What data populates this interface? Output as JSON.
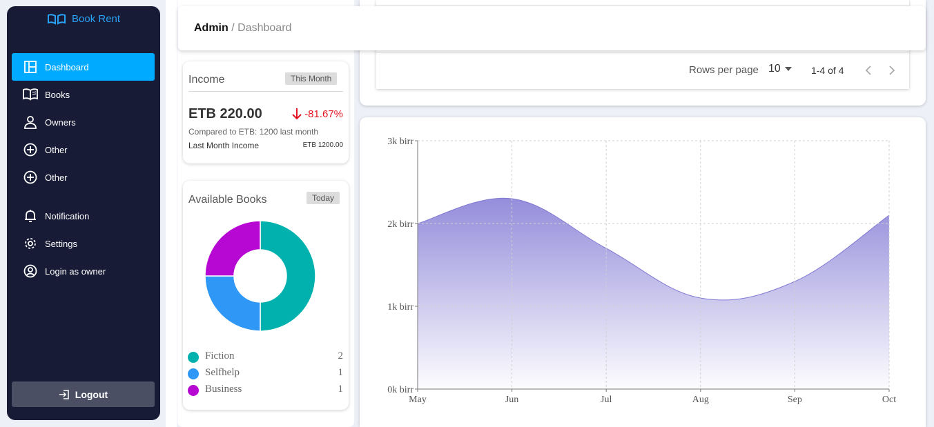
{
  "sidebar": {
    "brand": "Book Rent",
    "items": [
      {
        "label": "Dashboard",
        "icon": "dashboard-icon"
      },
      {
        "label": "Books",
        "icon": "book-icon"
      },
      {
        "label": "Owners",
        "icon": "person-icon"
      },
      {
        "label": "Other",
        "icon": "plus-circle-icon"
      },
      {
        "label": "Other",
        "icon": "plus-circle-icon"
      },
      {
        "label": "Notification",
        "icon": "bell-icon"
      },
      {
        "label": "Settings",
        "icon": "gear-icon"
      },
      {
        "label": "Login as owner",
        "icon": "account-circle-icon"
      }
    ],
    "logout": "Logout"
  },
  "header": {
    "crumb_root": "Admin",
    "separator": "/",
    "crumb_current": "Dashboard"
  },
  "income": {
    "title": "Income",
    "period": "This Month",
    "amount": "ETB 220.00",
    "change": "-81.67%",
    "compare": "Compared to ETB: 1200 last month",
    "last_label": "Last Month Income",
    "last_value": "ETB 1200.00"
  },
  "books": {
    "title": "Available Books",
    "period": "Today",
    "legend": [
      {
        "name": "Fiction",
        "value": "2",
        "color": "#00b1ad"
      },
      {
        "name": "Selfhelp",
        "value": "1",
        "color": "#2f98f6"
      },
      {
        "name": "Business",
        "value": "1",
        "color": "#b707d3"
      }
    ]
  },
  "table": {
    "rows_per_page_label": "Rows per page",
    "rows_per_page": "10",
    "range": "1-4 of 4"
  },
  "colors": {
    "accent": "#00abff",
    "sidebar": "#171b36",
    "area": "#9a93de",
    "negative": "#e5121f"
  },
  "chart_data": {
    "type": "area",
    "categories": [
      "May",
      "Jun",
      "Jul",
      "Aug",
      "Sep",
      "Oct"
    ],
    "values": [
      2000,
      2300,
      1700,
      1100,
      1300,
      2100
    ],
    "yticks": [
      "0k birr",
      "1k birr",
      "2k birr",
      "3k birr"
    ],
    "ylim": [
      0,
      3000
    ],
    "grid": true
  }
}
